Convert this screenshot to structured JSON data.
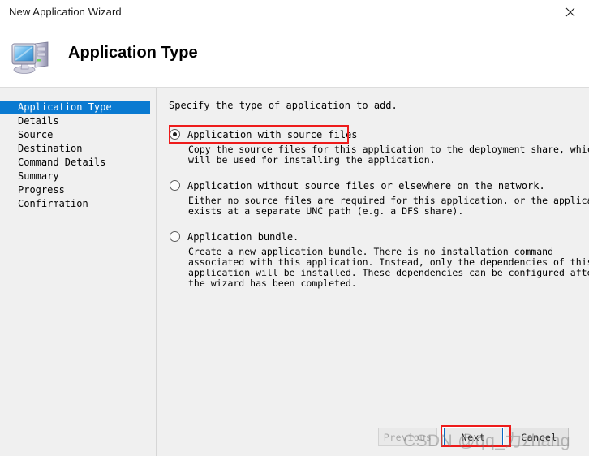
{
  "window": {
    "title": "New Application Wizard",
    "close_icon": "close-icon"
  },
  "banner": {
    "title": "Application Type",
    "icon": "computer-icon"
  },
  "sidebar": {
    "items": [
      {
        "label": "Application Type",
        "active": true
      },
      {
        "label": "Details",
        "active": false
      },
      {
        "label": "Source",
        "active": false
      },
      {
        "label": "Destination",
        "active": false
      },
      {
        "label": "Command Details",
        "active": false
      },
      {
        "label": "Summary",
        "active": false
      },
      {
        "label": "Progress",
        "active": false
      },
      {
        "label": "Confirmation",
        "active": false
      }
    ]
  },
  "main": {
    "intro": "Specify the type of application to add.",
    "options": [
      {
        "label": "Application with source files",
        "checked": true,
        "highlighted": true,
        "description_lines": [
          "Copy the source files for this application to the deployment share, which",
          "will be used for installing the application."
        ]
      },
      {
        "label": "Application without source files or elsewhere on the network.",
        "checked": false,
        "highlighted": false,
        "description_lines": [
          "Either no source files are required for this application, or the application",
          "exists at a separate UNC path (e.g. a DFS share)."
        ]
      },
      {
        "label": "Application bundle.",
        "checked": false,
        "highlighted": false,
        "description_lines": [
          "Create a new application bundle.  There is no installation command",
          "associated with this application.  Instead, only the dependencies of this",
          "application will be installed.  These dependencies can be configured after",
          "the wizard has been completed."
        ]
      }
    ]
  },
  "footer": {
    "previous_label": "Previous",
    "next_label": "Next",
    "cancel_label": "Cancel",
    "previous_disabled": true,
    "next_focused": true
  },
  "watermark": {
    "text": "CSDN @qq_力zhang"
  },
  "colors": {
    "accent": "#0a7ad1",
    "annotation": "#ee1b1b",
    "panel": "#f0f0f0",
    "focus": "#0a68c4"
  }
}
